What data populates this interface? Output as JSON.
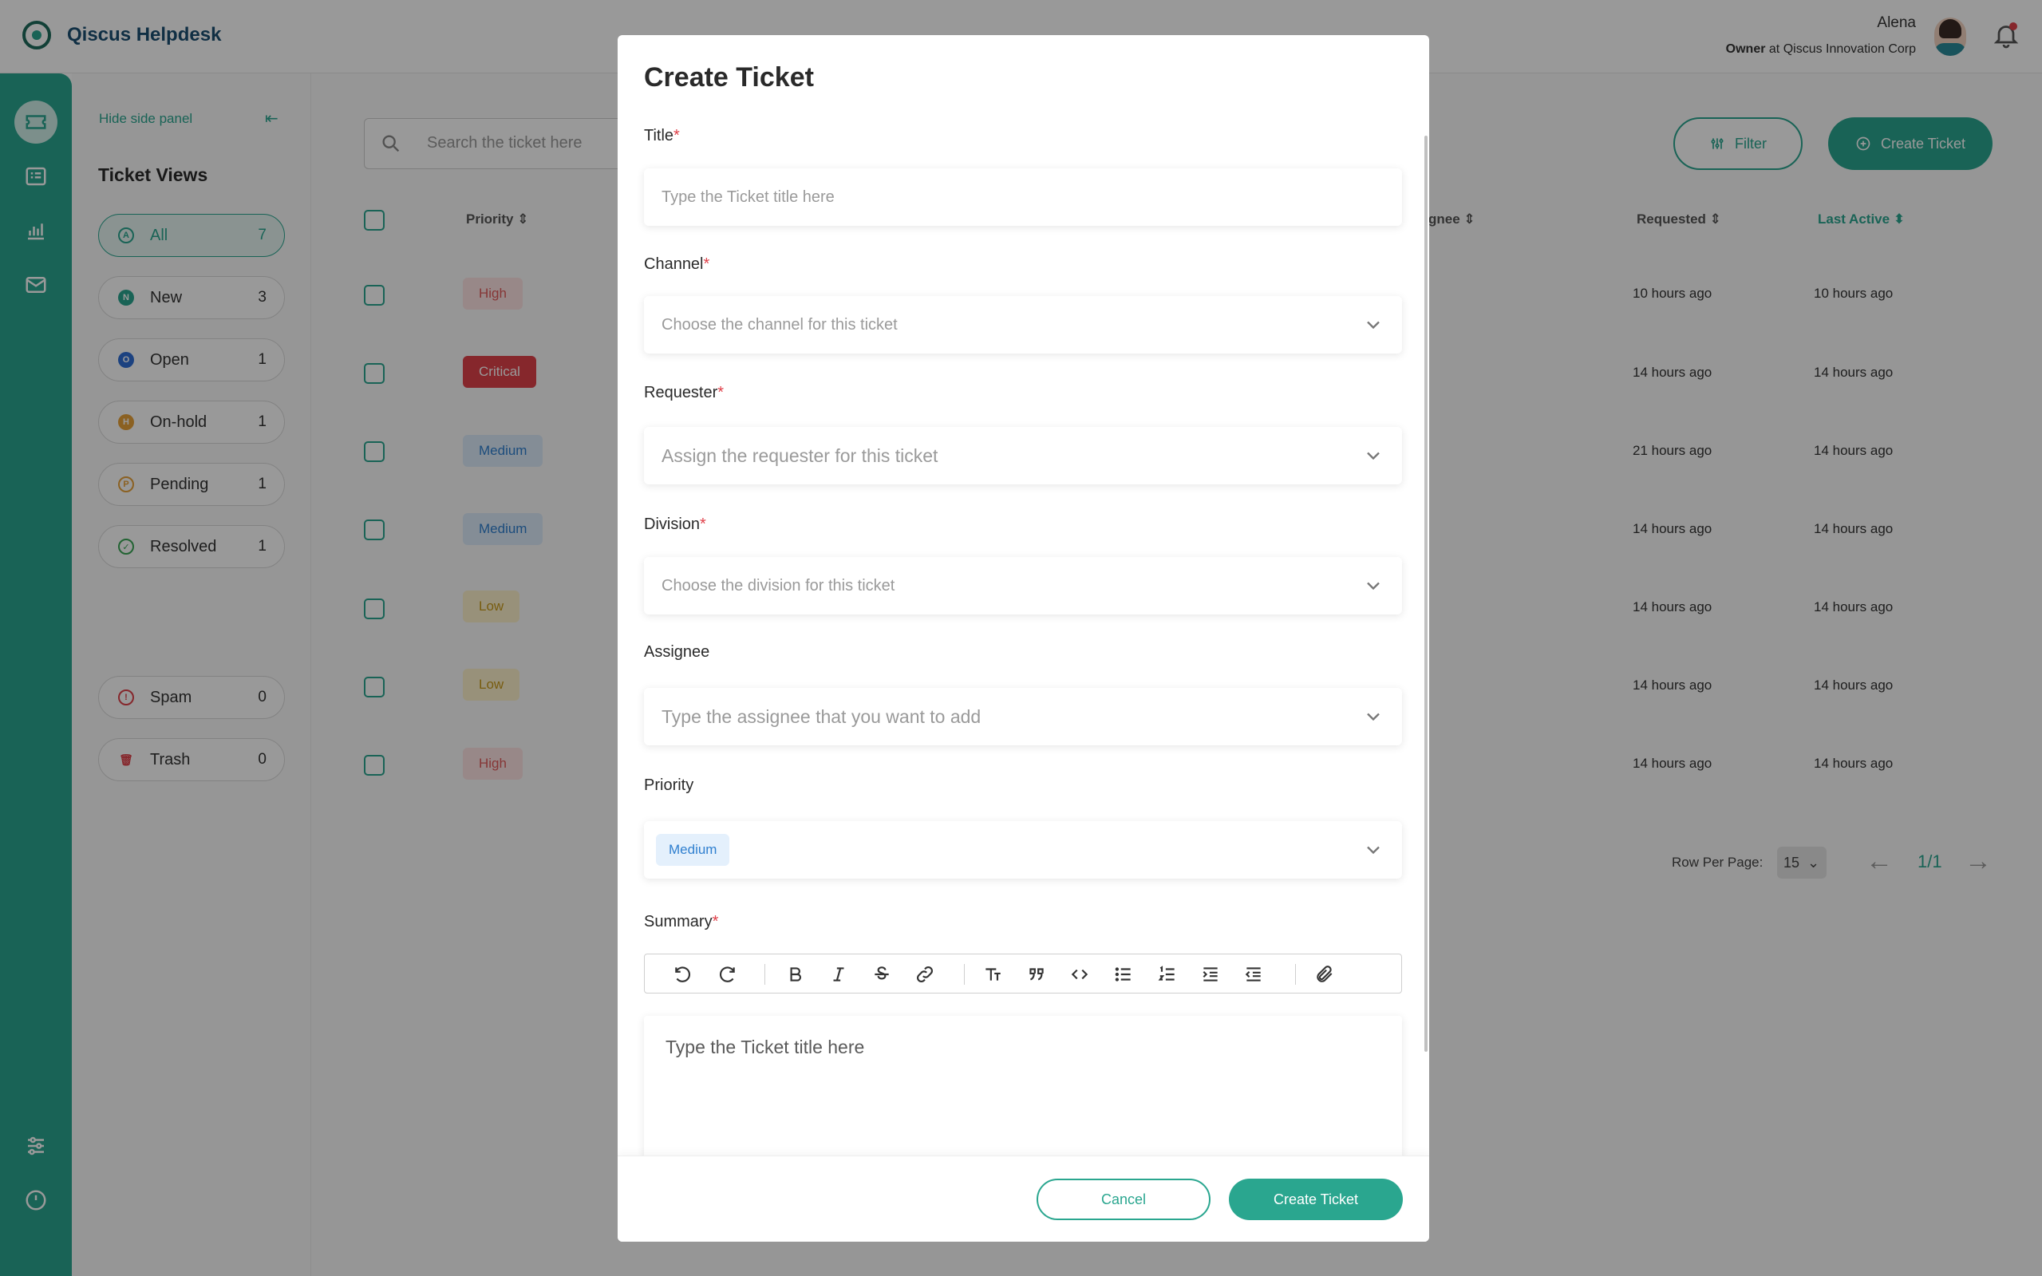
{
  "app": {
    "brand": "Qiscus Helpdesk",
    "user_name": "Alena",
    "user_role": "Owner",
    "user_org": "at Qiscus Innovation Corp"
  },
  "side_panel": {
    "hide_label": "Hide side panel",
    "title": "Ticket Views",
    "views": [
      {
        "label": "All",
        "count": "7",
        "letter": "A",
        "color": "#2aa68f"
      },
      {
        "label": "New",
        "count": "3",
        "letter": "N",
        "color": "#2aa68f"
      },
      {
        "label": "Open",
        "count": "1",
        "letter": "O",
        "color": "#2f6fd6"
      },
      {
        "label": "On-hold",
        "count": "1",
        "letter": "H",
        "color": "#e8a23a"
      },
      {
        "label": "Pending",
        "count": "1",
        "letter": "P",
        "color": "#e8a23a"
      },
      {
        "label": "Resolved",
        "count": "1",
        "letter": "✓",
        "color": "#3aa655"
      },
      {
        "label": "Spam",
        "count": "0",
        "letter": "!",
        "color": "#e0414a"
      },
      {
        "label": "Trash",
        "count": "0",
        "letter": "🗑",
        "color": "#e0414a"
      }
    ]
  },
  "main": {
    "search_placeholder": "Search the ticket here",
    "filter_label": "Filter",
    "create_label": "Create Ticket",
    "columns": {
      "priority": "Priority",
      "assignee": "gnee",
      "requested": "Requested",
      "last_active": "Last Active"
    },
    "rows": [
      {
        "priority": "High",
        "requested": "10 hours ago",
        "last_active": "10 hours ago"
      },
      {
        "priority": "Critical",
        "requested": "14 hours ago",
        "last_active": "14 hours ago"
      },
      {
        "priority": "Medium",
        "requested": "21 hours ago",
        "last_active": "14 hours ago"
      },
      {
        "priority": "Medium",
        "requested": "14 hours ago",
        "last_active": "14 hours ago"
      },
      {
        "priority": "Low",
        "requested": "14 hours ago",
        "last_active": "14 hours ago"
      },
      {
        "priority": "Low",
        "requested": "14 hours ago",
        "last_active": "14 hours ago"
      },
      {
        "priority": "High",
        "requested": "14 hours ago",
        "last_active": "14 hours ago"
      }
    ],
    "row_per_page_label": "Row Per Page:",
    "row_per_page_value": "15",
    "page_indicator": "1/1"
  },
  "modal": {
    "title": "Create Ticket",
    "fields": {
      "title": {
        "label": "Title",
        "placeholder": "Type the Ticket title here"
      },
      "channel": {
        "label": "Channel",
        "placeholder": "Choose the channel for this ticket"
      },
      "requester": {
        "label": "Requester",
        "placeholder": "Assign the requester for this ticket"
      },
      "division": {
        "label": "Division",
        "placeholder": "Choose the division for this ticket"
      },
      "assignee": {
        "label": "Assignee",
        "placeholder": "Type the assignee that you want to add"
      },
      "priority": {
        "label": "Priority",
        "value": "Medium"
      },
      "summary": {
        "label": "Summary",
        "placeholder": "Type the Ticket title here"
      }
    },
    "required_mark": "*",
    "cancel_label": "Cancel",
    "submit_label": "Create Ticket"
  }
}
